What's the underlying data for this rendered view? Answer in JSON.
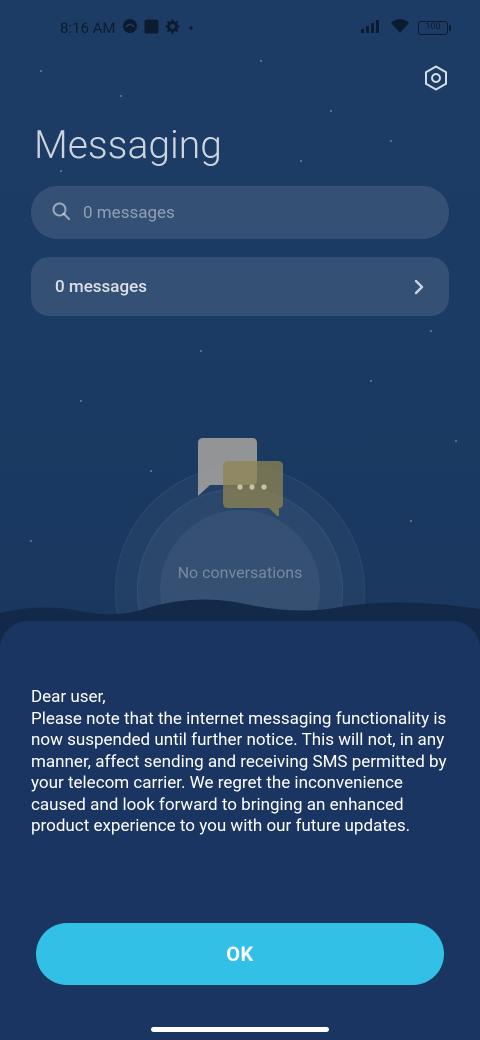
{
  "status_bar": {
    "time": "8:16 AM",
    "battery": "100",
    "icons": [
      "incognito-icon",
      "square-app-icon",
      "gear-icon",
      "dot-icon",
      "signal-icon",
      "wifi-icon",
      "battery-icon"
    ]
  },
  "header": {
    "title": "Messaging",
    "settings_icon": "hexagon-settings-icon"
  },
  "search": {
    "placeholder": "0 messages",
    "icon": "search-icon"
  },
  "summary_card": {
    "label": "0 messages",
    "icon": "chevron-right-icon"
  },
  "empty_state": {
    "text": "No conversations",
    "icon": "chat-bubbles-icon"
  },
  "dialog": {
    "message": "Dear user,\nPlease note that the internet messaging functionality is now suspended until further notice. This will not, in any manner, affect sending and receiving SMS permitted by your telecom carrier. We regret the inconvenience caused and look forward to bringing an enhanced product experience to you with our future updates.",
    "ok_label": "OK"
  },
  "colors": {
    "background": "#1b3a63",
    "dialog": "#1b3562",
    "accent": "#33c0e6"
  }
}
